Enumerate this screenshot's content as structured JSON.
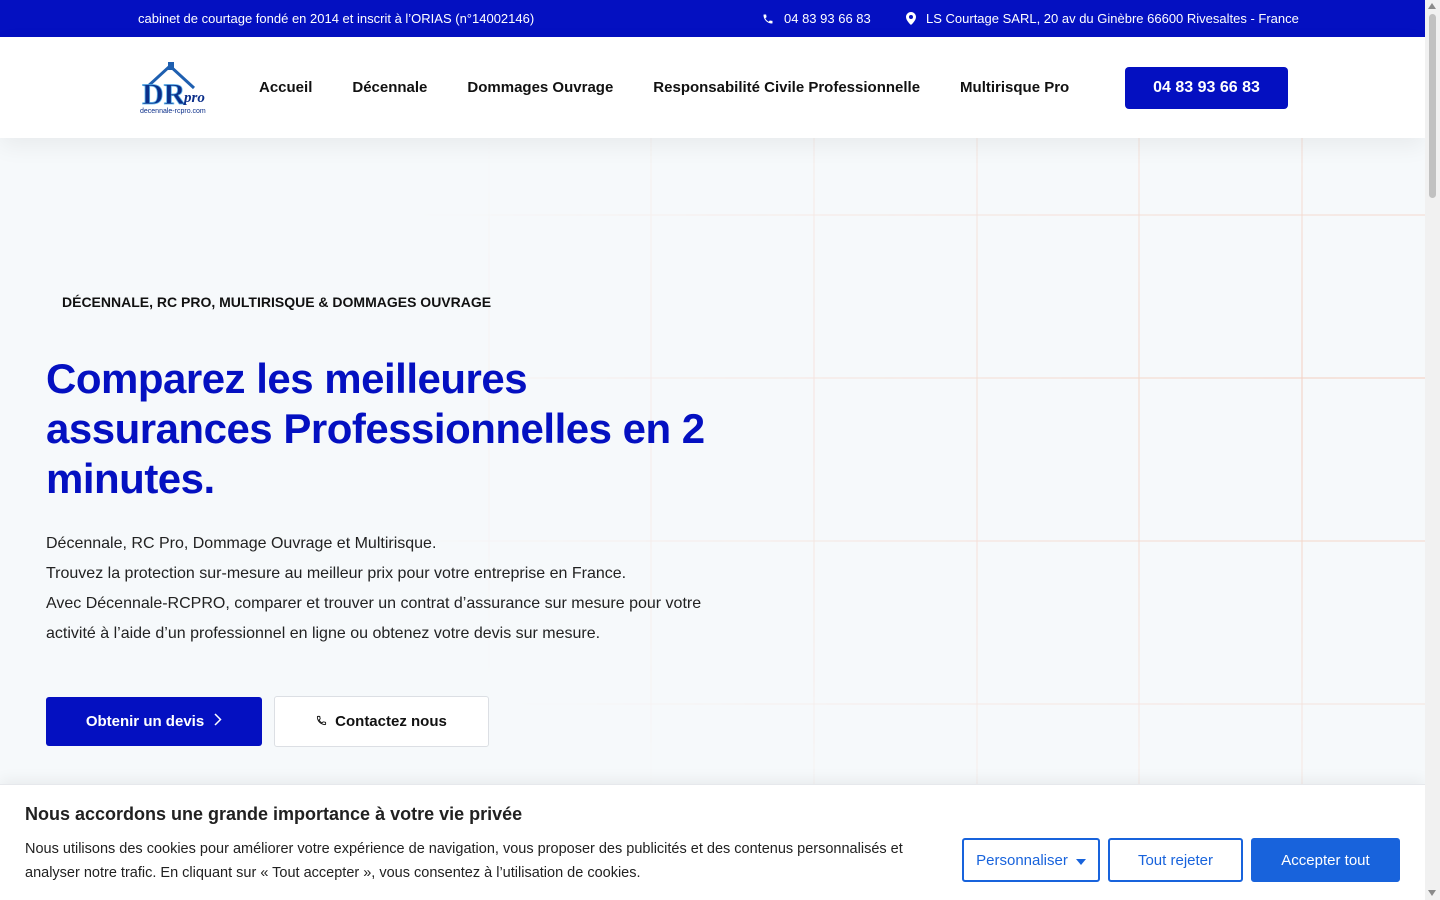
{
  "topbar": {
    "tagline": "cabinet de courtage fondé en 2014 et inscrit à l’ORIAS (n°14002146)",
    "phone": "04 83 93 66 83",
    "phone_icon": "phone-icon",
    "address": "LS Courtage SARL, 20 av du Ginèbre 66600 Rivesaltes - France",
    "address_icon": "map-pin-icon"
  },
  "header": {
    "logo_main": "DR",
    "logo_sub": "pro",
    "logo_caption": "decennale-rcpro.com",
    "nav": [
      {
        "label": "Accueil"
      },
      {
        "label": "Décennale"
      },
      {
        "label": "Dommages Ouvrage"
      },
      {
        "label": "Responsabilité Civile Professionnelle"
      },
      {
        "label": "Multirisque Pro"
      }
    ],
    "cta": "04 83 93 66 83"
  },
  "hero": {
    "eyebrow": "DÉCENNALE, RC PRO, MULTIRISQUE & DOMMAGES OUVRAGE",
    "title": "Comparez les meilleures assurances Professionnelles en 2 minutes.",
    "desc": [
      "Décennale, RC Pro, Dommage Ouvrage et Multirisque.",
      "Trouvez la protection sur-mesure au meilleur prix pour votre entreprise en France.",
      "Avec Décennale-RCPRO, comparer et trouver un contrat d’assurance sur mesure pour votre activité à l’aide d’un professionnel en ligne ou obtenez votre devis sur mesure."
    ],
    "primary_button": "Obtenir un devis",
    "primary_icon": "chevron-right-icon",
    "secondary_button": "Contactez nous",
    "secondary_icon": "phone-icon"
  },
  "cookie": {
    "title": "Nous accordons une grande importance à votre vie privée",
    "text": "Nous utilisons des cookies pour améliorer votre expérience de navigation, vous proposer des publicités et des contenus personnalisés et analyser notre trafic. En cliquant sur « Tout accepter », vous consentez à l’utilisation de cookies.",
    "customize": "Personnaliser",
    "customize_icon": "caret-down-icon",
    "reject": "Tout rejeter",
    "accept": "Accepter tout"
  },
  "colors": {
    "brand": "#0410c1",
    "cookie_accent": "#1863dc",
    "grid_line": "#f3c9b8"
  }
}
